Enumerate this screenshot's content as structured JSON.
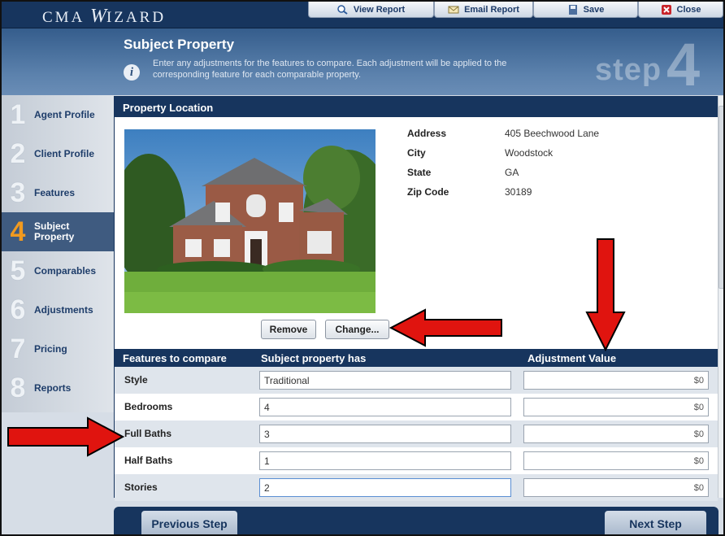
{
  "app": {
    "logo_prefix": "CMA",
    "logo_w": "W",
    "logo_suffix": "IZARD"
  },
  "toolbar": {
    "view_report": "View Report",
    "email_report": "Email Report",
    "save": "Save",
    "close": "Close"
  },
  "header": {
    "title": "Subject Property",
    "info_icon": "i",
    "description": "Enter any adjustments for the features to compare. Each adjustment will be applied to the corresponding feature for each comparable property.",
    "step_word": "step",
    "step_number": "4"
  },
  "sidebar": {
    "items": [
      {
        "num": "1",
        "label": "Agent Profile"
      },
      {
        "num": "2",
        "label": "Client Profile"
      },
      {
        "num": "3",
        "label": "Features"
      },
      {
        "num": "4",
        "label": "Subject Property",
        "active": true
      },
      {
        "num": "5",
        "label": "Comparables"
      },
      {
        "num": "6",
        "label": "Adjustments"
      },
      {
        "num": "7",
        "label": "Pricing"
      },
      {
        "num": "8",
        "label": "Reports"
      }
    ]
  },
  "property": {
    "section_title": "Property Location",
    "fields": [
      {
        "label": "Address",
        "value": "405 Beechwood Lane"
      },
      {
        "label": "City",
        "value": "Woodstock"
      },
      {
        "label": "State",
        "value": "GA"
      },
      {
        "label": "Zip Code",
        "value": "30189"
      }
    ],
    "remove_label": "Remove",
    "change_label": "Change..."
  },
  "features": {
    "headers": {
      "feature": "Features to compare",
      "subject": "Subject property has",
      "adjustment": "Adjustment Value"
    },
    "rows": [
      {
        "label": "Style",
        "value": "Traditional",
        "adjustment": "$0"
      },
      {
        "label": "Bedrooms",
        "value": "4",
        "adjustment": "$0"
      },
      {
        "label": "Full Baths",
        "value": "3",
        "adjustment": "$0"
      },
      {
        "label": "Half Baths",
        "value": "1",
        "adjustment": "$0"
      },
      {
        "label": "Stories",
        "value": "2",
        "adjustment": "$0"
      }
    ]
  },
  "footer": {
    "previous_label": "Previous Step",
    "next_label": "Next Step"
  },
  "colors": {
    "navy": "#17355e",
    "accent_orange": "#f19a1f",
    "arrow_red": "#e0140f"
  }
}
